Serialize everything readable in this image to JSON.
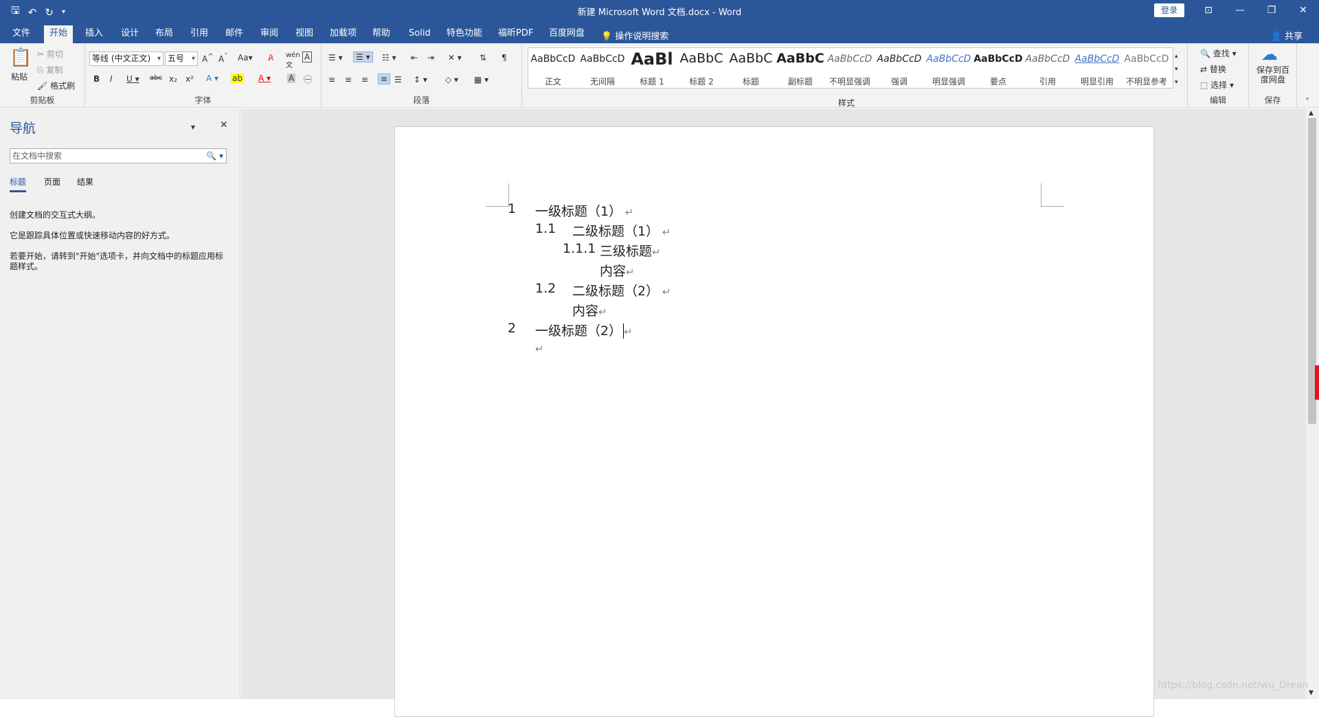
{
  "title": "新建 Microsoft Word 文档.docx  -  Word",
  "login": "登录",
  "share": "共享",
  "tell": "操作说明搜索",
  "menu": [
    "文件",
    "开始",
    "插入",
    "设计",
    "布局",
    "引用",
    "邮件",
    "审阅",
    "视图",
    "加载项",
    "帮助",
    "Solid",
    "特色功能",
    "福昕PDF",
    "百度网盘"
  ],
  "clipboard": {
    "paste": "粘贴",
    "cut": "剪切",
    "copy": "复制",
    "format_painter": "格式刷",
    "label": "剪贴板"
  },
  "font": {
    "name": "等线 (中文正文)",
    "size": "五号",
    "label": "字体"
  },
  "paragraph": {
    "label": "段落"
  },
  "styles": {
    "label": "样式",
    "items": [
      {
        "sample": "AaBbCcD",
        "name": "正文"
      },
      {
        "sample": "AaBbCcD",
        "name": "无间隔"
      },
      {
        "sample": "AaBl",
        "name": "标题 1"
      },
      {
        "sample": "AaBbC",
        "name": "标题 2"
      },
      {
        "sample": "AaBbC",
        "name": "标题"
      },
      {
        "sample": "AaBbC",
        "name": "副标题"
      },
      {
        "sample": "AaBbCcD",
        "name": "不明显强调"
      },
      {
        "sample": "AaBbCcD",
        "name": "强调"
      },
      {
        "sample": "AaBbCcD",
        "name": "明显强调"
      },
      {
        "sample": "AaBbCcD",
        "name": "要点"
      },
      {
        "sample": "AaBbCcD",
        "name": "引用"
      },
      {
        "sample": "AaBbCcD",
        "name": "明显引用"
      },
      {
        "sample": "AaBbCcD",
        "name": "不明显参考"
      }
    ]
  },
  "editing": {
    "find": "查找",
    "replace": "替换",
    "select": "选择",
    "label": "编辑"
  },
  "save": {
    "btn": "保存到百度网盘",
    "label": "保存"
  },
  "nav": {
    "title": "导航",
    "search_placeholder": "在文档中搜索",
    "tabs": [
      "标题",
      "页面",
      "结果"
    ],
    "p1": "创建文档的交互式大纲。",
    "p2": "它是跟踪具体位置或快速移动内容的好方式。",
    "p3": "若要开始，请转到\"开始\"选项卡，并向文档中的标题应用标题样式。"
  },
  "doc": [
    {
      "num": "1",
      "text": "一级标题（1）"
    },
    {
      "num": "1.1",
      "text": "二级标题（1）"
    },
    {
      "num": "1.1.1",
      "text": "三级标题"
    },
    {
      "num": "",
      "text": "内容"
    },
    {
      "num": "1.2",
      "text": "二级标题（2）"
    },
    {
      "num": "",
      "text": "内容"
    },
    {
      "num": "2",
      "text": "一级标题（2）"
    },
    {
      "num": "",
      "text": ""
    }
  ],
  "watermark": "https://blog.csdn.net/wu_Drean"
}
